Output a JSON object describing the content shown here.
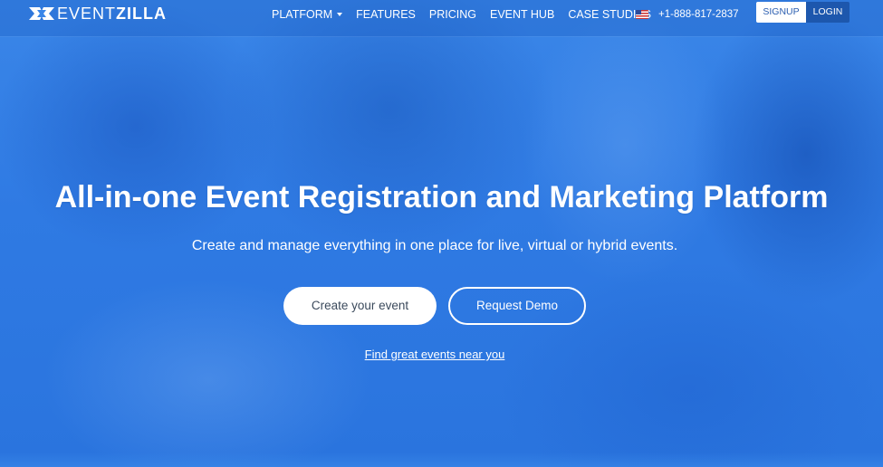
{
  "brand": {
    "logo_icon": "eventzilla-logo-icon",
    "logo_light": "EVENT",
    "logo_bold": "ZILLA"
  },
  "nav": {
    "items": [
      {
        "label": "PLATFORM",
        "has_dropdown": true
      },
      {
        "label": "FEATURES"
      },
      {
        "label": "PRICING"
      },
      {
        "label": "EVENT HUB"
      },
      {
        "label": "CASE STUDIES"
      }
    ],
    "flag_icon": "us-flag-icon",
    "phone": "+1-888-817-2837",
    "signup_label": "SIGNUP",
    "login_label": "LOGIN"
  },
  "hero": {
    "headline": "All-in-one Event Registration and Marketing Platform",
    "subheadline": "Create and manage everything in one place for live, virtual or hybrid events.",
    "primary_cta": "Create your event",
    "secondary_cta": "Request Demo",
    "find_link": "Find great events near you"
  },
  "colors": {
    "hero_blue": "#2f7fe6",
    "login_bg": "#1d57ad",
    "primary_cta_text": "#3b4a5c"
  }
}
